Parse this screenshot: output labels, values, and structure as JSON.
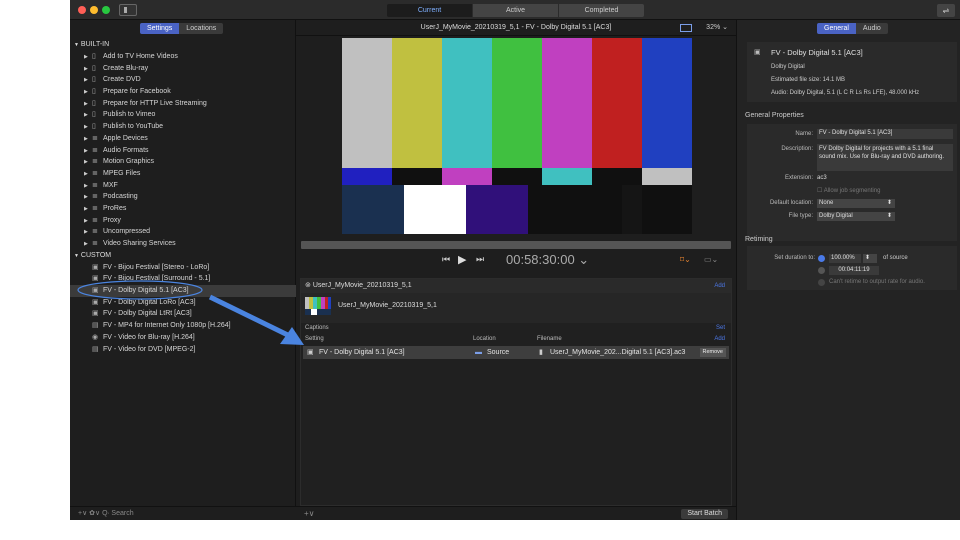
{
  "titlebar": {
    "seg_current": "Current",
    "seg_active": "Active",
    "seg_completed": "Completed"
  },
  "left": {
    "tab_settings": "Settings",
    "tab_locations": "Locations",
    "builtin_header": "BUILT-IN",
    "builtin_items": [
      "Add to TV Home Videos",
      "Create Blu-ray",
      "Create DVD",
      "Prepare for Facebook",
      "Prepare for HTTP Live Streaming",
      "Publish to Vimeo",
      "Publish to YouTube",
      "Apple Devices",
      "Audio Formats",
      "Motion Graphics",
      "MPEG Files",
      "MXF",
      "Podcasting",
      "ProRes",
      "Proxy",
      "Uncompressed",
      "Video Sharing Services"
    ],
    "custom_header": "CUSTOM",
    "custom_items": [
      "FV - Bijou Festival [Stereo - LoRo]",
      "FV - Bijou Festival [Surround - 5.1]",
      "FV - Dolby Digital 5.1 [AC3]",
      "FV - Dolby Digital LoRo [AC3]",
      "FV - Dolby Digital LtRt [AC3]",
      "FV - MP4 for Internet Only 1080p [H.264]",
      "FV - Video for Blu-ray [H.264]",
      "FV - Video for DVD [MPEG-2]"
    ],
    "bottom": "+∨   ✿∨   Q∙ Search"
  },
  "viewer": {
    "title": "UserJ_MyMovie_20210319_5,1 - FV - Dolby Digital 5.1 [AC3]",
    "zoom": "32% ⌄",
    "timecode": "00:58:30:00 ⌄"
  },
  "job": {
    "name": "UserJ_MyMovie_20210319_5,1",
    "add": "Add",
    "source_name": "UserJ_MyMovie_20210319_5,1",
    "captions": "Captions",
    "captions_set": "Set",
    "col_setting": "Setting",
    "col_location": "Location",
    "col_filename": "Filename",
    "col_add": "Add",
    "output": {
      "setting": "FV - Dolby Digital 5.1 [AC3]",
      "location": "Source",
      "filename": "UserJ_MyMovie_202...Digital 5.1 [AC3].ac3",
      "remove": "Remove"
    }
  },
  "center_bottom": {
    "plus": "+∨",
    "start_batch": "Start Batch"
  },
  "inspector": {
    "tab_general": "General",
    "tab_audio": "Audio",
    "summary_title": "FV - Dolby Digital 5.1 [AC3]",
    "summary_type": "Dolby Digital",
    "summary_size": "Estimated file size: 14.1 MB",
    "summary_audio": "Audio: Dolby Digital, 5.1 (L C R Ls Rs LFE), 48.000 kHz",
    "general_header": "General Properties",
    "name_label": "Name:",
    "name_value": "FV - Dolby Digital 5.1 [AC3]",
    "desc_label": "Description:",
    "desc_value": "FV Dolby Digital for projects with a 5.1 final sound mix.  Use for Blu-ray and DVD authoring.",
    "ext_label": "Extension:",
    "ext_value": "ac3",
    "allow_seg": "Allow job segmenting",
    "def_loc_label": "Default location:",
    "def_loc_value": "None",
    "file_type_label": "File type:",
    "file_type_value": "Dolby Digital",
    "retiming_header": "Retiming",
    "set_duration_label": "Set duration to:",
    "pct_value": "100.00%",
    "of_source": "of source",
    "duration_value": "00:04:11:19",
    "cant_retime": "Can't retime to output rate for audio."
  }
}
